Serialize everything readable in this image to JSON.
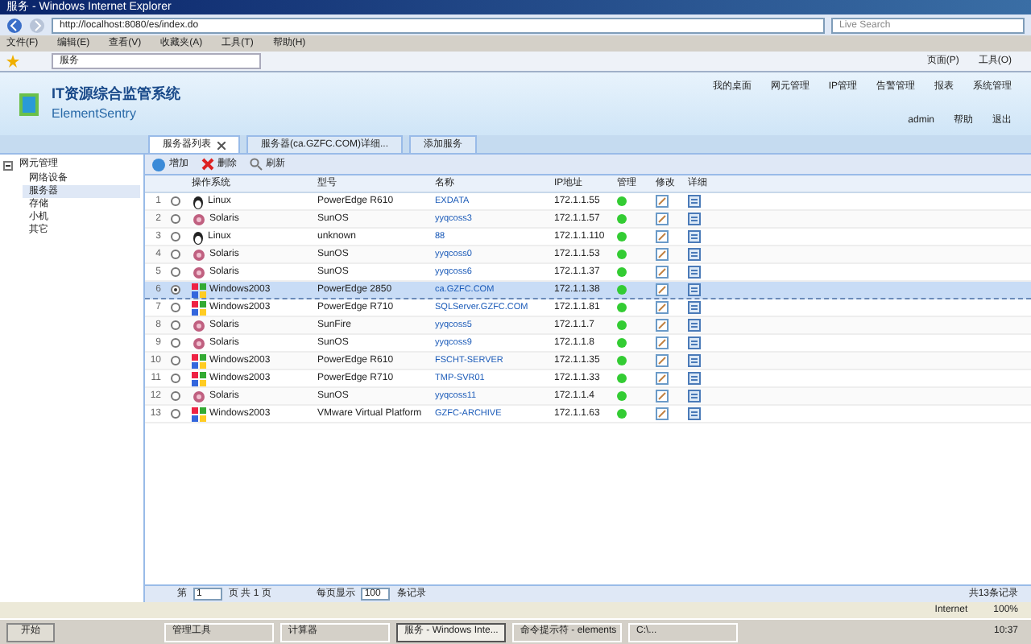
{
  "window": {
    "title": "服务 - Windows Internet Explorer"
  },
  "address_bar": {
    "url": "http://localhost:8080/es/index.do",
    "search_placeholder": "Live Search"
  },
  "menu": [
    "文件(F)",
    "编辑(E)",
    "查看(V)",
    "收藏夹(A)",
    "工具(T)",
    "帮助(H)"
  ],
  "favorites_tab": "服务",
  "ie_commands": [
    "页面(P)",
    "工具(O)"
  ],
  "app": {
    "title": "IT资源综合监管系统",
    "subtitle": "ElementSentry",
    "nav": [
      "我的桌面",
      "网元管理",
      "IP管理",
      "告警管理",
      "报表",
      "系统管理"
    ],
    "user": "admin",
    "links": [
      "帮助",
      "退出"
    ]
  },
  "tabs": [
    {
      "label": "服务器列表",
      "selected": true,
      "closable": true
    },
    {
      "label": "服务器(ca.GZFC.COM)详细...",
      "selected": false,
      "closable": false
    },
    {
      "label": "添加服务",
      "selected": false,
      "closable": false
    }
  ],
  "tree": {
    "label": "网元管理",
    "expanded": true,
    "children": [
      {
        "label": "网络设备",
        "selected": false
      },
      {
        "label": "服务器",
        "selected": true
      },
      {
        "label": "存储",
        "selected": false
      },
      {
        "label": "小机",
        "selected": false
      },
      {
        "label": "其它",
        "selected": false
      }
    ]
  },
  "toolbar": [
    {
      "kind": "add",
      "label": "增加"
    },
    {
      "kind": "delete",
      "label": "删除"
    },
    {
      "kind": "refresh",
      "label": "刷新"
    }
  ],
  "table": {
    "columns": [
      "操作系统",
      "型号",
      "名称",
      "IP地址",
      "管理",
      "修改",
      "详细"
    ],
    "rows": [
      {
        "no": "1",
        "os": "Linux",
        "kind": "linux",
        "model": "PowerEdge R610",
        "name": "EXDATA",
        "ip": "172.1.1.55",
        "selected": false
      },
      {
        "no": "2",
        "os": "Solaris",
        "kind": "solaris",
        "model": "SunOS",
        "name": "yyqcoss3",
        "ip": "172.1.1.57",
        "selected": false
      },
      {
        "no": "3",
        "os": "Linux",
        "kind": "linux",
        "model": "unknown",
        "name": "88",
        "ip": "172.1.1.110",
        "selected": false
      },
      {
        "no": "4",
        "os": "Solaris",
        "kind": "solaris",
        "model": "SunOS",
        "name": "yyqcoss0",
        "ip": "172.1.1.53",
        "selected": false
      },
      {
        "no": "5",
        "os": "Solaris",
        "kind": "solaris",
        "model": "SunOS",
        "name": "yyqcoss6",
        "ip": "172.1.1.37",
        "selected": false
      },
      {
        "no": "6",
        "os": "Windows2003",
        "kind": "windows",
        "model": "PowerEdge 2850",
        "name": "ca.GZFC.COM",
        "ip": "172.1.1.38",
        "selected": true
      },
      {
        "no": "7",
        "os": "Windows2003",
        "kind": "windows",
        "model": "PowerEdge R710",
        "name": "SQLServer.GZFC.COM",
        "ip": "172.1.1.81",
        "selected": false
      },
      {
        "no": "8",
        "os": "Solaris",
        "kind": "solaris",
        "model": "SunFire",
        "name": "yyqcoss5",
        "ip": "172.1.1.7",
        "selected": false
      },
      {
        "no": "9",
        "os": "Solaris",
        "kind": "solaris",
        "model": "SunOS",
        "name": "yyqcoss9",
        "ip": "172.1.1.8",
        "selected": false
      },
      {
        "no": "10",
        "os": "Windows2003",
        "kind": "windows",
        "model": "PowerEdge R610",
        "name": "FSCHT-SERVER",
        "ip": "172.1.1.35",
        "selected": false
      },
      {
        "no": "11",
        "os": "Windows2003",
        "kind": "windows",
        "model": "PowerEdge R710",
        "name": "TMP-SVR01",
        "ip": "172.1.1.33",
        "selected": false
      },
      {
        "no": "12",
        "os": "Solaris",
        "kind": "solaris",
        "model": "SunOS",
        "name": "yyqcoss11",
        "ip": "172.1.1.4",
        "selected": false
      },
      {
        "no": "13",
        "os": "Windows2003",
        "kind": "windows",
        "model": "VMware Virtual Platform",
        "name": "GZFC-ARCHIVE",
        "ip": "172.1.1.63",
        "selected": false
      }
    ]
  },
  "pager": {
    "page_prefix": "第",
    "page": "1",
    "page_suffix": "页 共 1 页",
    "per_page_prefix": "每页显示",
    "per_page": "100",
    "per_page_suffix": "条记录",
    "total": "共13条记录"
  },
  "status_bar": {
    "zone": "Internet",
    "zoom": "100%"
  },
  "taskbar": {
    "start": "开始",
    "tasks": [
      {
        "label": "管理工具",
        "selected": false
      },
      {
        "label": "计算器",
        "selected": false
      },
      {
        "label": "服务 - Windows Inte...",
        "selected": true
      },
      {
        "label": "命令提示符 - elements",
        "selected": false
      },
      {
        "label": "C:\\...",
        "selected": false
      }
    ],
    "clock": "10:37"
  }
}
